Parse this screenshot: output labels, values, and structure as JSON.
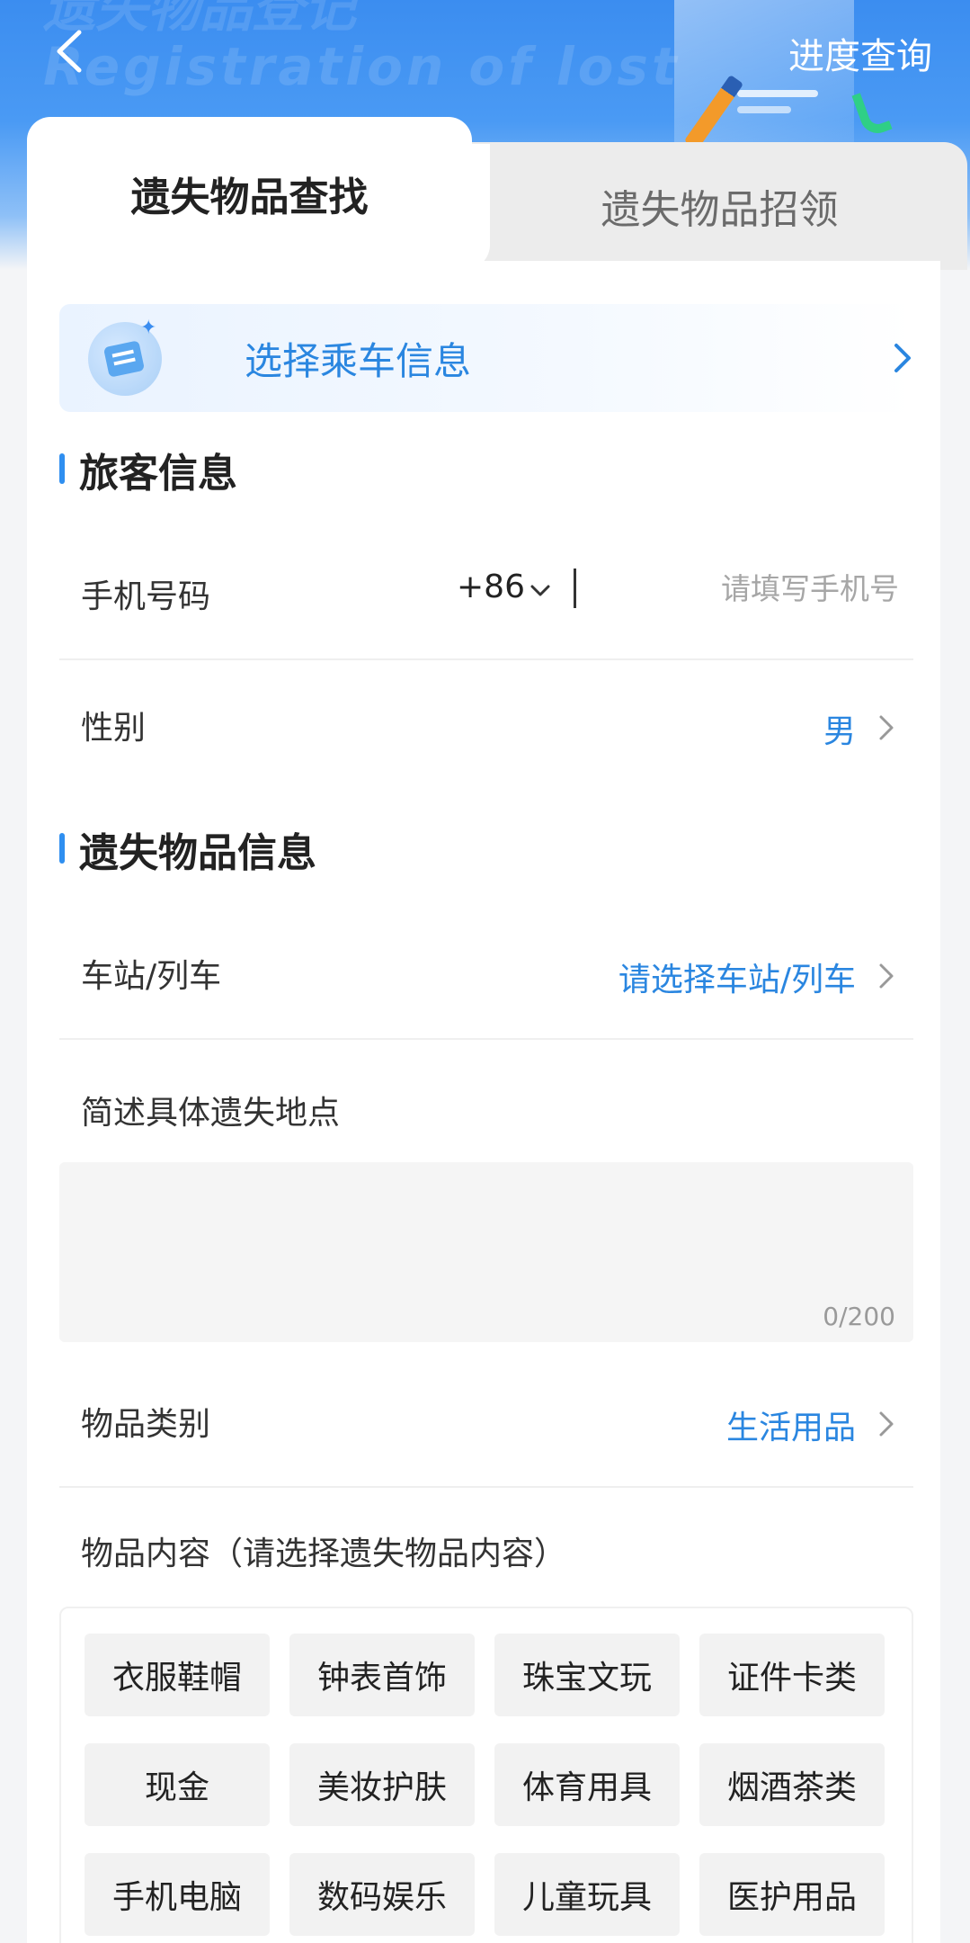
{
  "header": {
    "back_icon": "chevron-left-icon",
    "progress_link": "进度查询",
    "ghost_text": "Registration of lost"
  },
  "tabs": [
    {
      "label": "遗失物品查找",
      "active": true
    },
    {
      "label": "遗失物品招领",
      "active": false
    }
  ],
  "ride_banner": {
    "label": "选择乘车信息",
    "icon": "ticket-document-icon"
  },
  "passenger_section": {
    "title": "旅客信息",
    "phone": {
      "label": "手机号码",
      "country_code": "+86",
      "placeholder": "请填写手机号",
      "value": ""
    },
    "gender": {
      "label": "性别",
      "value": "男"
    }
  },
  "item_section": {
    "title": "遗失物品信息",
    "station": {
      "label": "车站/列车",
      "value": "请选择车站/列车"
    },
    "location": {
      "label": "简述具体遗失地点",
      "counter": "0/200"
    },
    "category": {
      "label": "物品类别",
      "value": "生活用品"
    },
    "content_label": "物品内容（请选择遗失物品内容）",
    "chips": [
      "衣服鞋帽",
      "钟表首饰",
      "珠宝文玩",
      "证件卡类",
      "现金",
      "美妆护肤",
      "体育用具",
      "烟酒茶类",
      "手机电脑",
      "数码娱乐",
      "儿童玩具",
      "医护用品"
    ]
  },
  "colors": {
    "accent": "#2a86e0",
    "header_blue": "#3b8df0"
  }
}
